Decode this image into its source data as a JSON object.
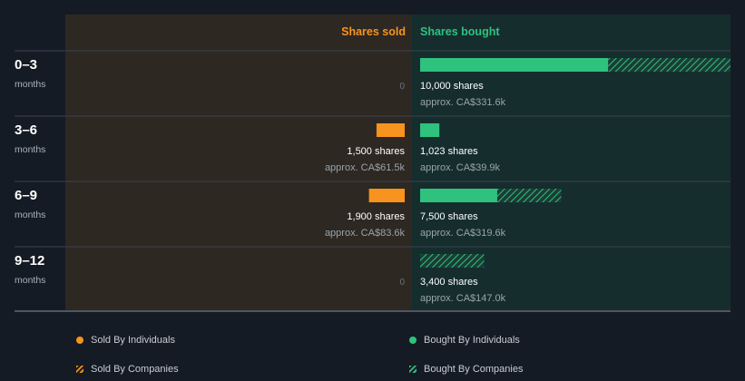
{
  "chart_data": {
    "type": "bar",
    "headers": {
      "sold": "Shares sold",
      "bought": "Shares bought"
    },
    "rows": [
      {
        "period": "0–3",
        "unit": "months",
        "sold": {
          "individuals": 0,
          "companies": 0,
          "zero_label": "0",
          "shares_label": "",
          "value_label": ""
        },
        "bought": {
          "individuals": 10000,
          "companies": 6500,
          "shares_label": "10,000 shares",
          "value_label": "approx. CA$331.6k"
        }
      },
      {
        "period": "3–6",
        "unit": "months",
        "sold": {
          "individuals": 1500,
          "companies": 0,
          "zero_label": "",
          "shares_label": "1,500 shares",
          "value_label": "approx. CA$61.5k"
        },
        "bought": {
          "individuals": 1023,
          "companies": 0,
          "shares_label": "1,023 shares",
          "value_label": "approx. CA$39.9k"
        }
      },
      {
        "period": "6–9",
        "unit": "months",
        "sold": {
          "individuals": 1900,
          "companies": 0,
          "zero_label": "",
          "shares_label": "1,900 shares",
          "value_label": "approx. CA$83.6k"
        },
        "bought": {
          "individuals": 4100,
          "companies": 3400,
          "shares_label": "7,500 shares",
          "value_label": "approx. CA$319.6k"
        }
      },
      {
        "period": "9–12",
        "unit": "months",
        "sold": {
          "individuals": 0,
          "companies": 0,
          "zero_label": "0",
          "shares_label": "",
          "value_label": ""
        },
        "bought": {
          "individuals": 0,
          "companies": 3400,
          "shares_label": "3,400 shares",
          "value_label": "approx. CA$147.0k"
        }
      }
    ],
    "legend": [
      {
        "key": "sold_individuals",
        "label": "Sold By Individuals",
        "color": "#f7931e",
        "style": "dot"
      },
      {
        "key": "bought_individuals",
        "label": "Bought By Individuals",
        "color": "#2ec27e",
        "style": "dot"
      },
      {
        "key": "sold_companies",
        "label": "Sold By Companies",
        "color": "#f7931e",
        "style": "hatch"
      },
      {
        "key": "bought_companies",
        "label": "Bought By Companies",
        "color": "#2ec27e",
        "style": "hatch"
      }
    ],
    "scale_max_shares": 16500,
    "colors": {
      "sold": "#f7931e",
      "bought": "#2ec27e",
      "sold_panel": "#2d2822",
      "bought_panel": "#162d2e",
      "background": "#151b24"
    }
  }
}
